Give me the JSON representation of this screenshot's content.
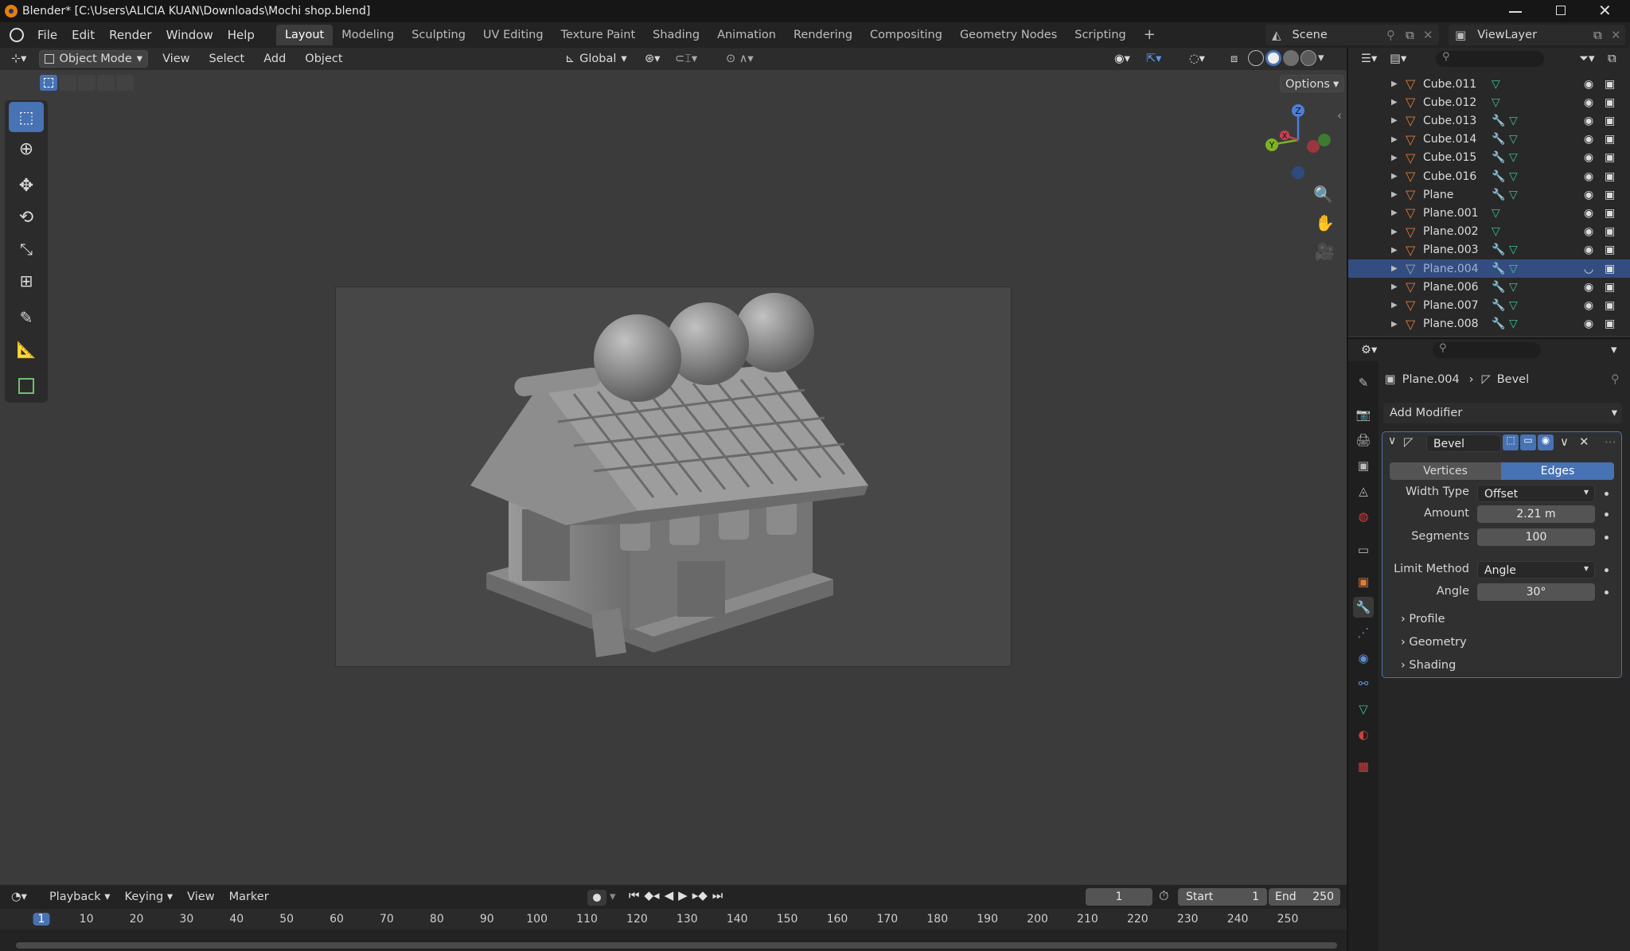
{
  "titlebar": {
    "title": "Blender* [C:\\Users\\ALICIA KUAN\\Downloads\\Mochi shop.blend]"
  },
  "menu": {
    "items": [
      "File",
      "Edit",
      "Render",
      "Window",
      "Help"
    ]
  },
  "workspaces": [
    "Layout",
    "Modeling",
    "Sculpting",
    "UV Editing",
    "Texture Paint",
    "Shading",
    "Animation",
    "Rendering",
    "Compositing",
    "Geometry Nodes",
    "Scripting"
  ],
  "scene": {
    "name": "Scene",
    "view_layer": "ViewLayer"
  },
  "viewport": {
    "mode": "Object Mode",
    "menus": [
      "View",
      "Select",
      "Add",
      "Object"
    ],
    "orientation": "Global",
    "options_label": "Options",
    "gizmo": {
      "z": "Z",
      "y": "Y",
      "x": "X"
    }
  },
  "outliner": {
    "rows": [
      {
        "name": "Cube.011",
        "modifier": false,
        "selected": false
      },
      {
        "name": "Cube.012",
        "modifier": false,
        "selected": false
      },
      {
        "name": "Cube.013",
        "modifier": true,
        "selected": false
      },
      {
        "name": "Cube.014",
        "modifier": true,
        "selected": false
      },
      {
        "name": "Cube.015",
        "modifier": true,
        "selected": false
      },
      {
        "name": "Cube.016",
        "modifier": true,
        "selected": false
      },
      {
        "name": "Plane",
        "modifier": true,
        "selected": false
      },
      {
        "name": "Plane.001",
        "modifier": false,
        "selected": false
      },
      {
        "name": "Plane.002",
        "modifier": false,
        "selected": false
      },
      {
        "name": "Plane.003",
        "modifier": true,
        "selected": false
      },
      {
        "name": "Plane.004",
        "modifier": true,
        "selected": true
      },
      {
        "name": "Plane.006",
        "modifier": true,
        "selected": false
      },
      {
        "name": "Plane.007",
        "modifier": true,
        "selected": false
      },
      {
        "name": "Plane.008",
        "modifier": true,
        "selected": false
      }
    ]
  },
  "properties": {
    "breadcrumb_object": "Plane.004",
    "breadcrumb_modifier": "Bevel",
    "add_modifier": "Add Modifier",
    "modifier_name": "Bevel",
    "affect_vertices": "Vertices",
    "affect_edges": "Edges",
    "width_type_label": "Width Type",
    "width_type_value": "Offset",
    "amount_label": "Amount",
    "amount_value": "2.21 m",
    "segments_label": "Segments",
    "segments_value": "100",
    "limit_method_label": "Limit Method",
    "limit_method_value": "Angle",
    "angle_label": "Angle",
    "angle_value": "30°",
    "panels": [
      "Profile",
      "Geometry",
      "Shading"
    ]
  },
  "timeline": {
    "menus": [
      "Playback",
      "Keying",
      "View",
      "Marker"
    ],
    "current_frame": "1",
    "start_label": "Start",
    "start_value": "1",
    "end_label": "End",
    "end_value": "250",
    "ruler": [
      {
        "label": "1",
        "frame": 1
      },
      {
        "label": "10",
        "frame": 10
      },
      {
        "label": "20",
        "frame": 20
      },
      {
        "label": "30",
        "frame": 30
      },
      {
        "label": "40",
        "frame": 40
      },
      {
        "label": "50",
        "frame": 50
      },
      {
        "label": "60",
        "frame": 60
      },
      {
        "label": "70",
        "frame": 70
      },
      {
        "label": "80",
        "frame": 80
      },
      {
        "label": "90",
        "frame": 90
      },
      {
        "label": "100",
        "frame": 100
      },
      {
        "label": "110",
        "frame": 110
      },
      {
        "label": "120",
        "frame": 120
      },
      {
        "label": "130",
        "frame": 130
      },
      {
        "label": "140",
        "frame": 140
      },
      {
        "label": "150",
        "frame": 150
      },
      {
        "label": "160",
        "frame": 160
      },
      {
        "label": "170",
        "frame": 170
      },
      {
        "label": "180",
        "frame": 180
      },
      {
        "label": "190",
        "frame": 190
      },
      {
        "label": "200",
        "frame": 200
      },
      {
        "label": "210",
        "frame": 210
      },
      {
        "label": "220",
        "frame": 220
      },
      {
        "label": "230",
        "frame": 230
      },
      {
        "label": "240",
        "frame": 240
      },
      {
        "label": "250",
        "frame": 250
      }
    ]
  },
  "colors": {
    "accent": "#4772b3",
    "selected_row": "#334d80",
    "mesh_icon": "#e07d3a",
    "modifier_icon": "#5d8fd8",
    "data_icon": "#3ac18f"
  },
  "icons": [
    "blender-logo-icon",
    "search-icon",
    "filter-icon",
    "eye-icon",
    "camera-icon",
    "wrench-icon",
    "mesh-data-icon",
    "zoom-icon",
    "hand-icon",
    "camera-view-icon"
  ]
}
